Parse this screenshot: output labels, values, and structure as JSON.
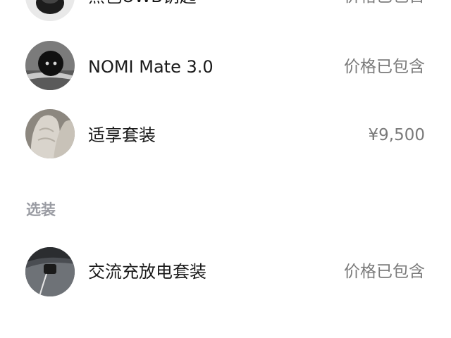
{
  "items_included": [
    {
      "name": "黑色UWB钥匙",
      "price": "价格已包含",
      "thumb_icon": "uwb-key-thumb"
    },
    {
      "name": "NOMI Mate 3.0",
      "price": "价格已包含",
      "thumb_icon": "nomi-robot-thumb"
    },
    {
      "name": "适享套装",
      "price": "¥9,500",
      "thumb_icon": "seat-thumb"
    }
  ],
  "optional_section": {
    "title": "选装",
    "items": [
      {
        "name": "交流充放电套装",
        "price": "价格已包含",
        "thumb_icon": "charger-thumb"
      }
    ]
  },
  "colors": {
    "name_text": "#1a1a1a",
    "price_text": "#7a7a7a",
    "section_title": "#9a9ca3",
    "background": "#ffffff"
  }
}
